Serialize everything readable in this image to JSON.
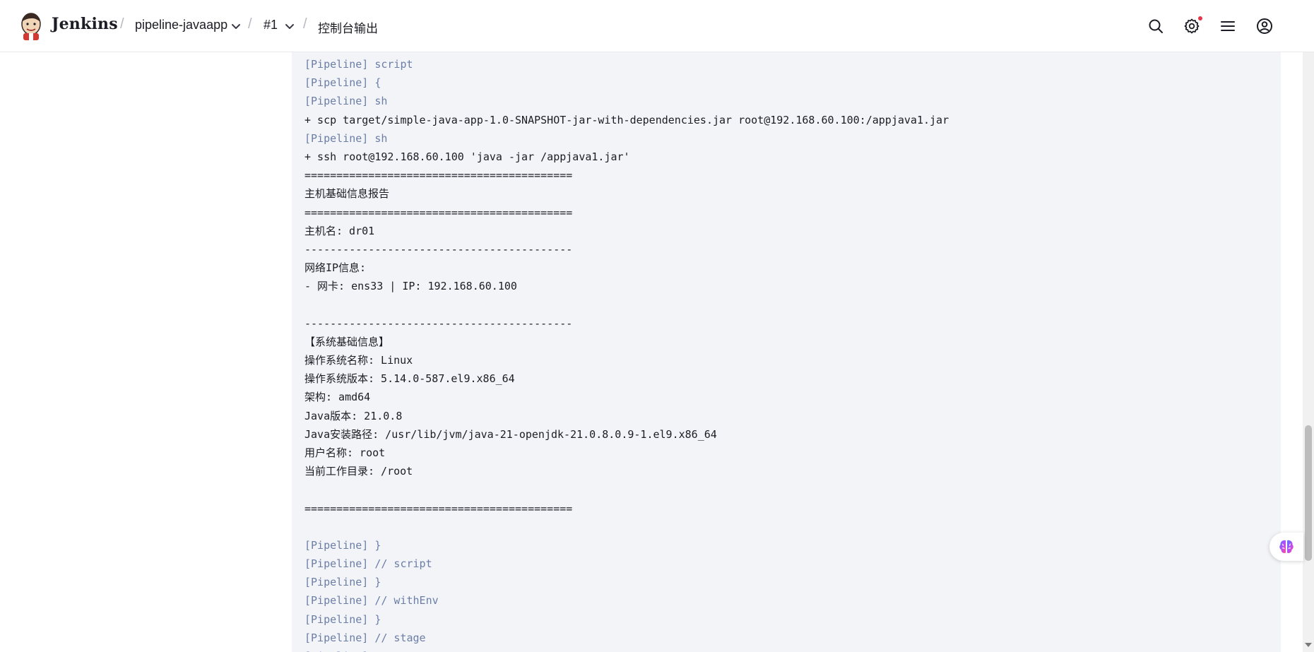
{
  "header": {
    "brand": "Jenkins",
    "breadcrumb": [
      {
        "label": "pipeline-javaapp",
        "has_menu": true
      },
      {
        "label": "#1",
        "has_menu": true
      },
      {
        "label": "控制台输出",
        "has_menu": false
      }
    ],
    "separator": "/",
    "actions": [
      "search-icon",
      "settings-icon",
      "menu-icon",
      "account-icon"
    ],
    "notification_dot_color": "#e5364a"
  },
  "console": {
    "lines": [
      {
        "text": "[Pipeline] script",
        "kind": "pipeline"
      },
      {
        "text": "[Pipeline] {",
        "kind": "pipeline"
      },
      {
        "text": "[Pipeline] sh",
        "kind": "pipeline"
      },
      {
        "text": "+ scp target/simple-java-app-1.0-SNAPSHOT-jar-with-dependencies.jar root@192.168.60.100:/appjava1.jar",
        "kind": "output"
      },
      {
        "text": "[Pipeline] sh",
        "kind": "pipeline"
      },
      {
        "text": "+ ssh root@192.168.60.100 'java -jar /appjava1.jar'",
        "kind": "output"
      },
      {
        "text": "==========================================",
        "kind": "output"
      },
      {
        "text": "主机基础信息报告",
        "kind": "output"
      },
      {
        "text": "==========================================",
        "kind": "output"
      },
      {
        "text": "主机名: dr01",
        "kind": "output"
      },
      {
        "text": "------------------------------------------",
        "kind": "output"
      },
      {
        "text": "网络IP信息:",
        "kind": "output"
      },
      {
        "text": "- 网卡: ens33 | IP: 192.168.60.100",
        "kind": "output"
      },
      {
        "text": "",
        "kind": "output"
      },
      {
        "text": "------------------------------------------",
        "kind": "output"
      },
      {
        "text": "【系统基础信息】",
        "kind": "output"
      },
      {
        "text": "操作系统名称: Linux",
        "kind": "output"
      },
      {
        "text": "操作系统版本: 5.14.0-587.el9.x86_64",
        "kind": "output"
      },
      {
        "text": "架构: amd64",
        "kind": "output"
      },
      {
        "text": "Java版本: 21.0.8",
        "kind": "output"
      },
      {
        "text": "Java安装路径: /usr/lib/jvm/java-21-openjdk-21.0.8.0.9-1.el9.x86_64",
        "kind": "output"
      },
      {
        "text": "用户名称: root",
        "kind": "output"
      },
      {
        "text": "当前工作目录: /root",
        "kind": "output"
      },
      {
        "text": "",
        "kind": "output"
      },
      {
        "text": "==========================================",
        "kind": "output"
      },
      {
        "text": "",
        "kind": "output"
      },
      {
        "text": "[Pipeline] }",
        "kind": "pipeline"
      },
      {
        "text": "[Pipeline] // script",
        "kind": "pipeline"
      },
      {
        "text": "[Pipeline] }",
        "kind": "pipeline"
      },
      {
        "text": "[Pipeline] // withEnv",
        "kind": "pipeline"
      },
      {
        "text": "[Pipeline] }",
        "kind": "pipeline"
      },
      {
        "text": "[Pipeline] // stage",
        "kind": "pipeline"
      },
      {
        "text": "[Pipeline] stage",
        "kind": "pipeline"
      }
    ]
  },
  "floating_button": "brain-icon"
}
